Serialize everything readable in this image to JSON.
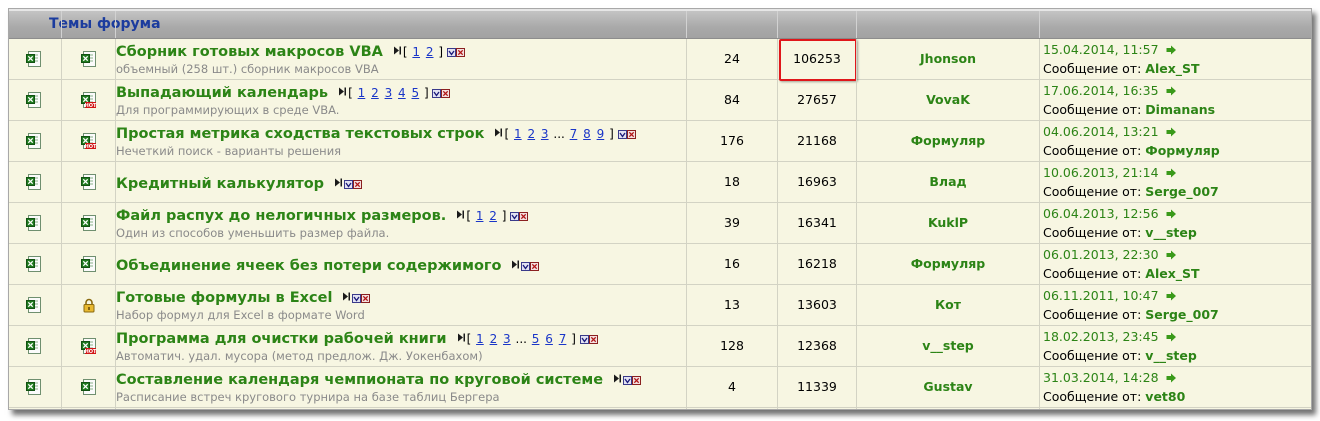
{
  "forum": {
    "title": "Темы форума",
    "page_prefix": "[",
    "page_suffix": "]",
    "ellipsis": "...",
    "last_post_prefix": "Сообщение от:"
  },
  "colors": {
    "header_title": "#1b3c9e",
    "topic_link": "#2c8416",
    "page_link": "#1a36c8",
    "description": "#8a8a8a",
    "row_background": "#f7f6e2",
    "highlight": "#e0161a"
  },
  "highlight": {
    "row": 0,
    "column": "views"
  },
  "topics": [
    {
      "status_icon": "excel-file-icon",
      "type_icon": "excel-file-icon",
      "title": "Сборник готовых макросов VBA",
      "pages": [
        "1",
        "2"
      ],
      "pages_tail": [],
      "description": "объемный (258 шт.) сборник макросов VBA",
      "replies": "24",
      "views": "106253",
      "author": "Jhonson",
      "last_date": "15.04.2014, 11:57",
      "last_user": "Alex_ST"
    },
    {
      "status_icon": "excel-file-icon",
      "type_icon": "hot-topic-icon",
      "title": "Выпадающий календарь",
      "pages": [
        "1",
        "2",
        "3",
        "4",
        "5"
      ],
      "pages_tail": [],
      "description": "Для программирующих в среде VBA.",
      "replies": "84",
      "views": "27657",
      "author": "VovaK",
      "last_date": "17.06.2014, 16:35",
      "last_user": "Dimanans"
    },
    {
      "status_icon": "excel-file-icon",
      "type_icon": "hot-topic-icon",
      "title": "Простая метрика сходства текстовых строк",
      "pages": [
        "1",
        "2",
        "3"
      ],
      "pages_tail": [
        "7",
        "8",
        "9"
      ],
      "description": "Нечеткий поиск - варианты решения",
      "replies": "176",
      "views": "21168",
      "author": "Формуляр",
      "last_date": "04.06.2014, 13:21",
      "last_user": "Формуляр"
    },
    {
      "status_icon": "excel-file-icon",
      "type_icon": "excel-file-icon",
      "title": "Кредитный калькулятор",
      "pages": [],
      "pages_tail": [],
      "description": "",
      "replies": "18",
      "views": "16963",
      "author": "Влад",
      "last_date": "10.06.2013, 21:14",
      "last_user": "Serge_007"
    },
    {
      "status_icon": "excel-file-icon",
      "type_icon": "excel-file-icon",
      "title": "Файл распух до нелогичных размеров.",
      "pages": [
        "1",
        "2"
      ],
      "pages_tail": [],
      "description": "Один из способов уменьшить размер файла.",
      "replies": "39",
      "views": "16341",
      "author": "KuklP",
      "last_date": "06.04.2013, 12:56",
      "last_user": "v__step"
    },
    {
      "status_icon": "excel-file-icon",
      "type_icon": "excel-file-icon",
      "title": "Объединение ячеек без потери содержимого",
      "pages": [],
      "pages_tail": [],
      "description": "",
      "replies": "16",
      "views": "16218",
      "author": "Формуляр",
      "last_date": "06.01.2013, 22:30",
      "last_user": "Alex_ST"
    },
    {
      "status_icon": "excel-file-icon",
      "type_icon": "lock-icon",
      "title": "Готовые формулы в Excel",
      "pages": [],
      "pages_tail": [],
      "description": "Набор формул для Excel в формате Word",
      "replies": "13",
      "views": "13603",
      "author": "Кот",
      "last_date": "06.11.2011, 10:47",
      "last_user": "Serge_007"
    },
    {
      "status_icon": "excel-file-icon",
      "type_icon": "hot-topic-icon",
      "title": "Программа для очистки рабочей книги",
      "pages": [
        "1",
        "2",
        "3"
      ],
      "pages_tail": [
        "5",
        "6",
        "7"
      ],
      "description": "Автоматич. удал. мусора (метод предлож. Дж. Уокенбахом)",
      "replies": "128",
      "views": "12368",
      "author": "v__step",
      "last_date": "18.02.2013, 23:45",
      "last_user": "v__step"
    },
    {
      "status_icon": "excel-file-icon",
      "type_icon": "excel-file-icon",
      "title": "Составление календаря чемпионата по круговой системе",
      "pages": [],
      "pages_tail": [],
      "description": "Расписание встреч кругового турнира на базе таблиц Бергера",
      "replies": "4",
      "views": "11339",
      "author": "Gustav",
      "last_date": "31.03.2014, 14:28",
      "last_user": "vet80"
    }
  ]
}
